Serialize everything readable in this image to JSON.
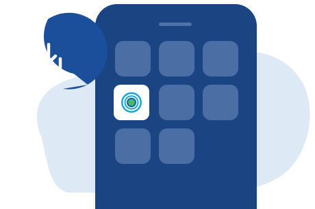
{
  "colors": {
    "background": "#ffffff",
    "blob": "#ddeaf6",
    "phone_body": "#1b4483",
    "phone_speaker": "#4f72a8",
    "app_tile": "#4b6ea4",
    "bubble": "#1b4f9c",
    "bubble_icon": "#ffffff",
    "app_icon_bg": "#ffffff",
    "target_ring_outer": "#17a9d3",
    "target_ring_dark": "#0e6da4",
    "target_center": "#4eb96a"
  },
  "icons": {
    "download": "download-tray-icon",
    "app": "target-app-icon"
  },
  "phone": {
    "app_grid": {
      "rows": 3,
      "columns": 3,
      "filled_slots": 8,
      "highlighted_slot": 4
    }
  }
}
